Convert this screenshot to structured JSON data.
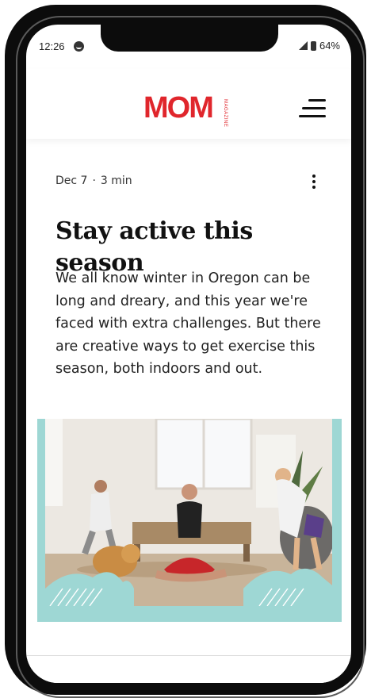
{
  "status_bar": {
    "time": "12:26",
    "battery": "64%"
  },
  "header": {
    "logo_text": "MOM",
    "logo_subtext": "MAGAZINE",
    "brand_color": "#e0262c"
  },
  "post": {
    "date": "Dec 7",
    "separator": "·",
    "read_time": "3 min",
    "title": "Stay active this season",
    "excerpt": "We all know winter in Oregon can be long and dreary, and this year we're faced with extra challenges. But there are creative ways to get exercise this season, both indoors and out.",
    "frame_color": "#9ed7d4"
  },
  "icons": {
    "status_message": "messenger-icon",
    "signal": "signal-icon",
    "battery": "battery-icon",
    "menu": "hamburger-menu-icon",
    "more": "more-vertical-icon"
  }
}
